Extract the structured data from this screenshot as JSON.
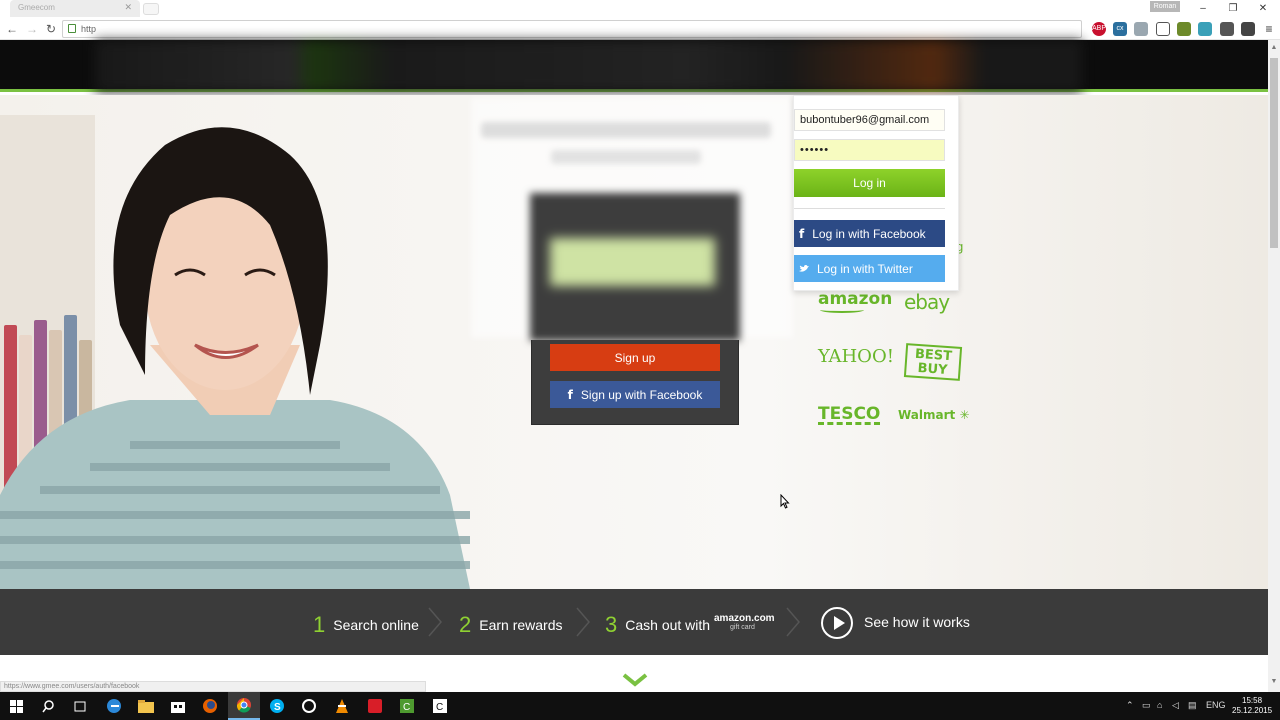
{
  "browser": {
    "tab_title": "Gmeecom",
    "url_text": "http",
    "user_chip": "Roman",
    "status_url": "https://www.gmee.com/users/auth/facebook",
    "ext_abp": "ABP",
    "ext_cx": "cx"
  },
  "login": {
    "email": "bubontuber96@gmail.com",
    "password_mask": "••••••",
    "login_label": "Log in",
    "facebook_label": "Log in with Facebook",
    "twitter_label": "Log in with Twitter"
  },
  "signup": {
    "signup_label": "Sign up",
    "facebook_label": "Sign up with Facebook"
  },
  "partners": {
    "amazon": "amazon",
    "ebay": "ebay",
    "yahoo": "YAHOO!",
    "bestbuy": "BEST BUY",
    "tesco": "TESCO",
    "walmart": "Walmart",
    "walmart_spark": "✳",
    "partial": "g"
  },
  "steps": [
    {
      "num": "1",
      "label": "Search online"
    },
    {
      "num": "2",
      "label": "Earn rewards"
    },
    {
      "num": "3",
      "label": "Cash out with"
    }
  ],
  "amazon_gc": {
    "brand": "amazon.com",
    "sub": "gift card"
  },
  "see_how": "See how it works",
  "taskbar": {
    "lang": "ENG",
    "time": "15:58",
    "date": "25.12.2015"
  },
  "colors": {
    "accent_green": "#7ac142",
    "signup_red": "#d73d12",
    "facebook_blue": "#3b5998",
    "twitter_blue": "#55acee",
    "steps_bar": "#3b3b3b"
  }
}
